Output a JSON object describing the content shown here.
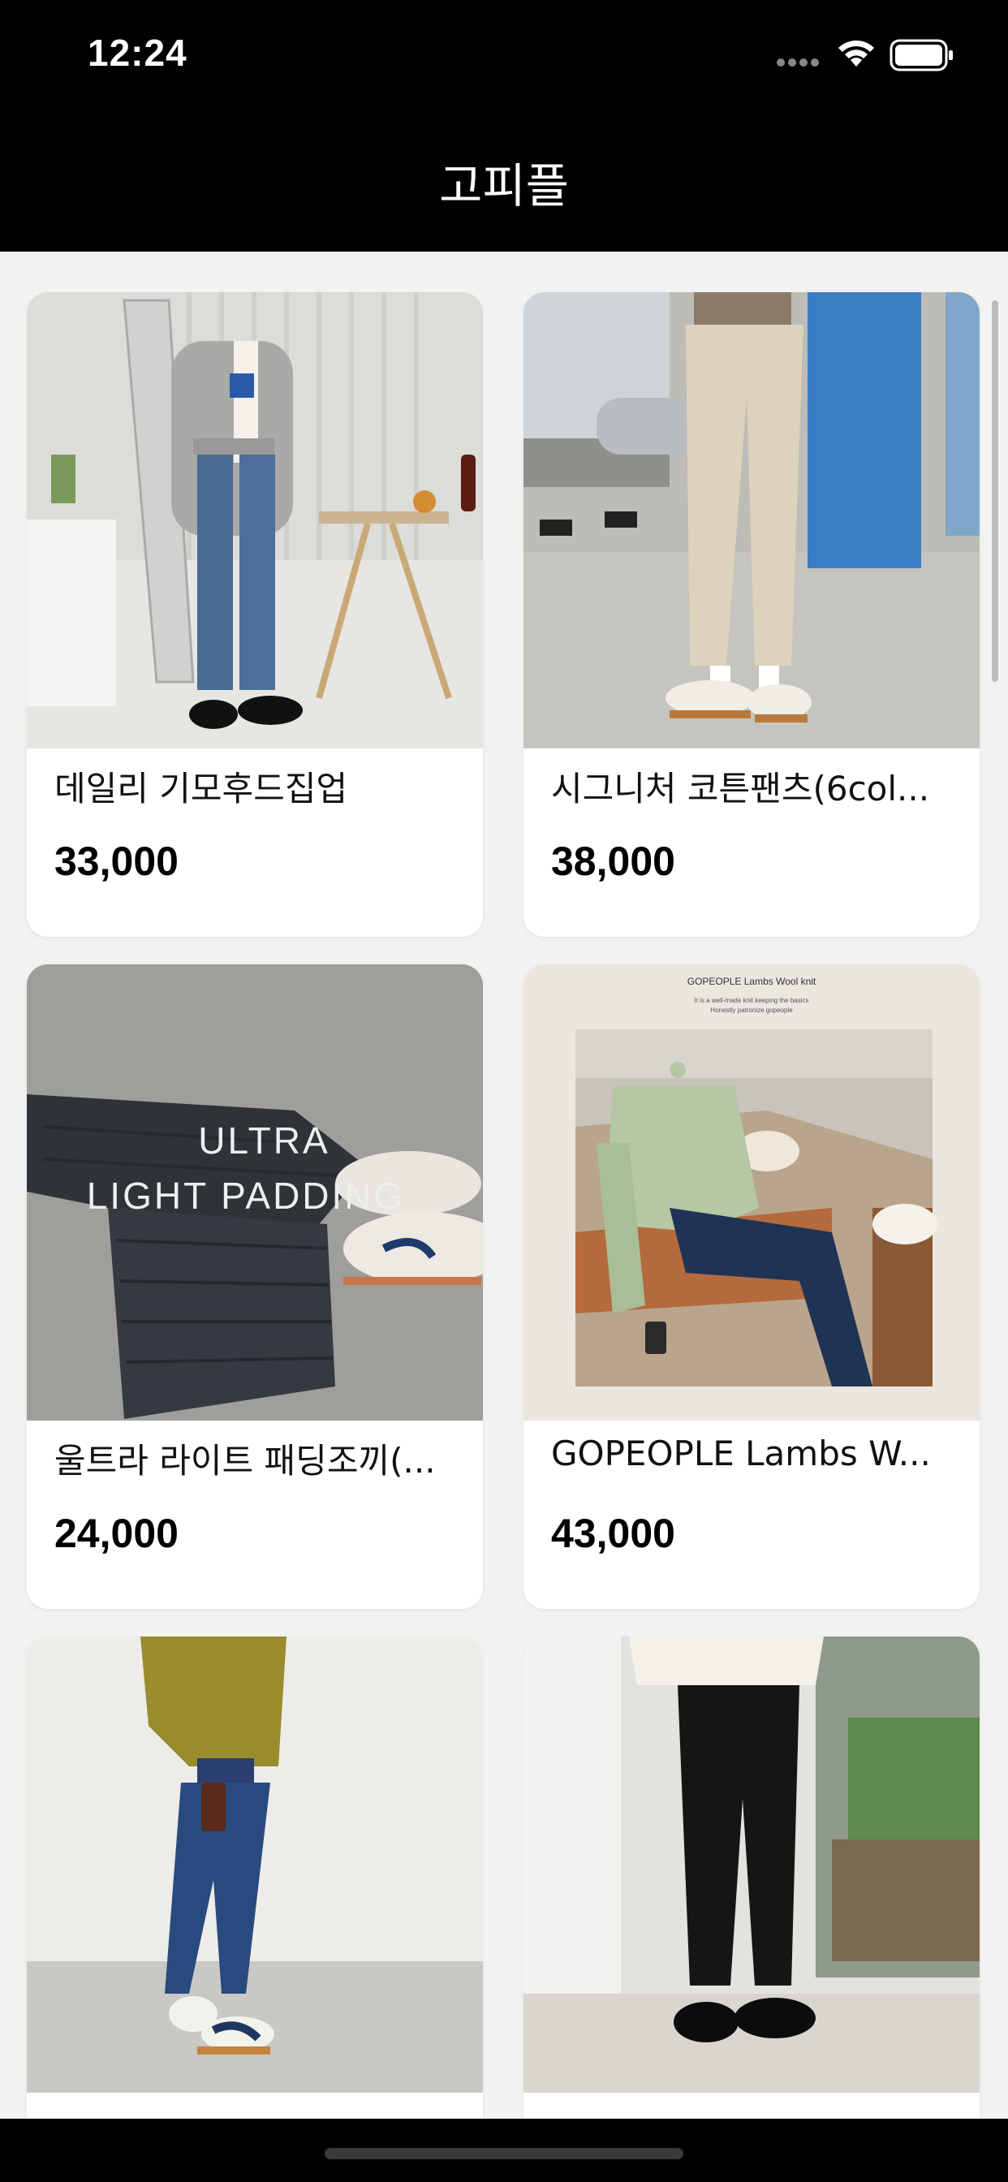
{
  "status_bar": {
    "time": "12:24"
  },
  "nav": {
    "title": "고피플"
  },
  "products": [
    {
      "name": "데일리 기모후드집업",
      "price": "33,000"
    },
    {
      "name": "시그니처 코튼팬츠(6col...",
      "price": "38,000"
    },
    {
      "name": "울트라 라이트 패딩조끼(...",
      "price": "24,000",
      "overlay_line1": "ULTRA",
      "overlay_line2": "LIGHT PADDING"
    },
    {
      "name": "GOPEOPLE Lambs W...",
      "price": "43,000",
      "overlay_title": "GOPEOPLE Lambs Wool knit",
      "overlay_sub1": "It is a well-made knit keeping the basics",
      "overlay_sub2": "Honestly patronize gopeople"
    },
    {
      "name": "",
      "price": ""
    },
    {
      "name": "",
      "price": ""
    }
  ]
}
